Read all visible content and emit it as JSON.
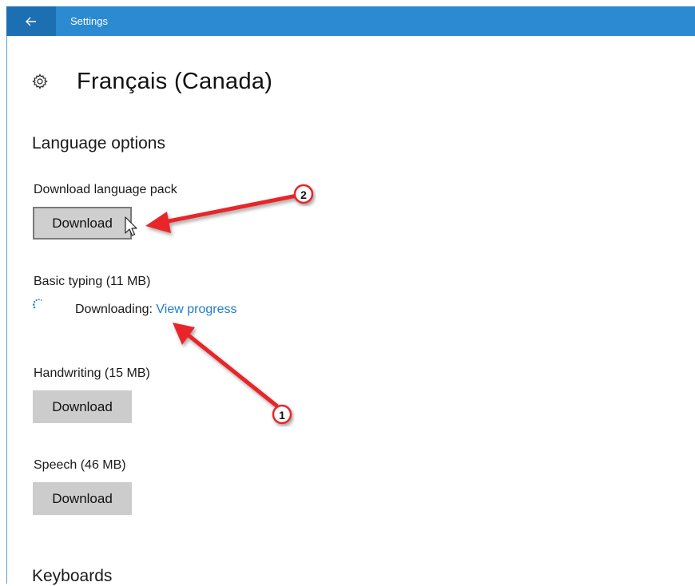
{
  "window": {
    "title": "Settings",
    "accent_color": "#2b8ad1",
    "back_icon": "arrow-left-icon"
  },
  "page": {
    "icon": "gear-icon",
    "title": "Français (Canada)"
  },
  "language_options": {
    "heading": "Language options",
    "language_pack": {
      "label": "Download language pack",
      "button": "Download"
    },
    "basic_typing": {
      "label": "Basic typing (11 MB)",
      "status": "Downloading:",
      "link": "View progress"
    },
    "handwriting": {
      "label": "Handwriting (15 MB)",
      "button": "Download"
    },
    "speech": {
      "label": "Speech (46 MB)",
      "button": "Download"
    }
  },
  "keyboards": {
    "heading": "Keyboards"
  },
  "annotations": [
    {
      "number": "1",
      "color": "#e8262a"
    },
    {
      "number": "2",
      "color": "#e8262a"
    }
  ]
}
